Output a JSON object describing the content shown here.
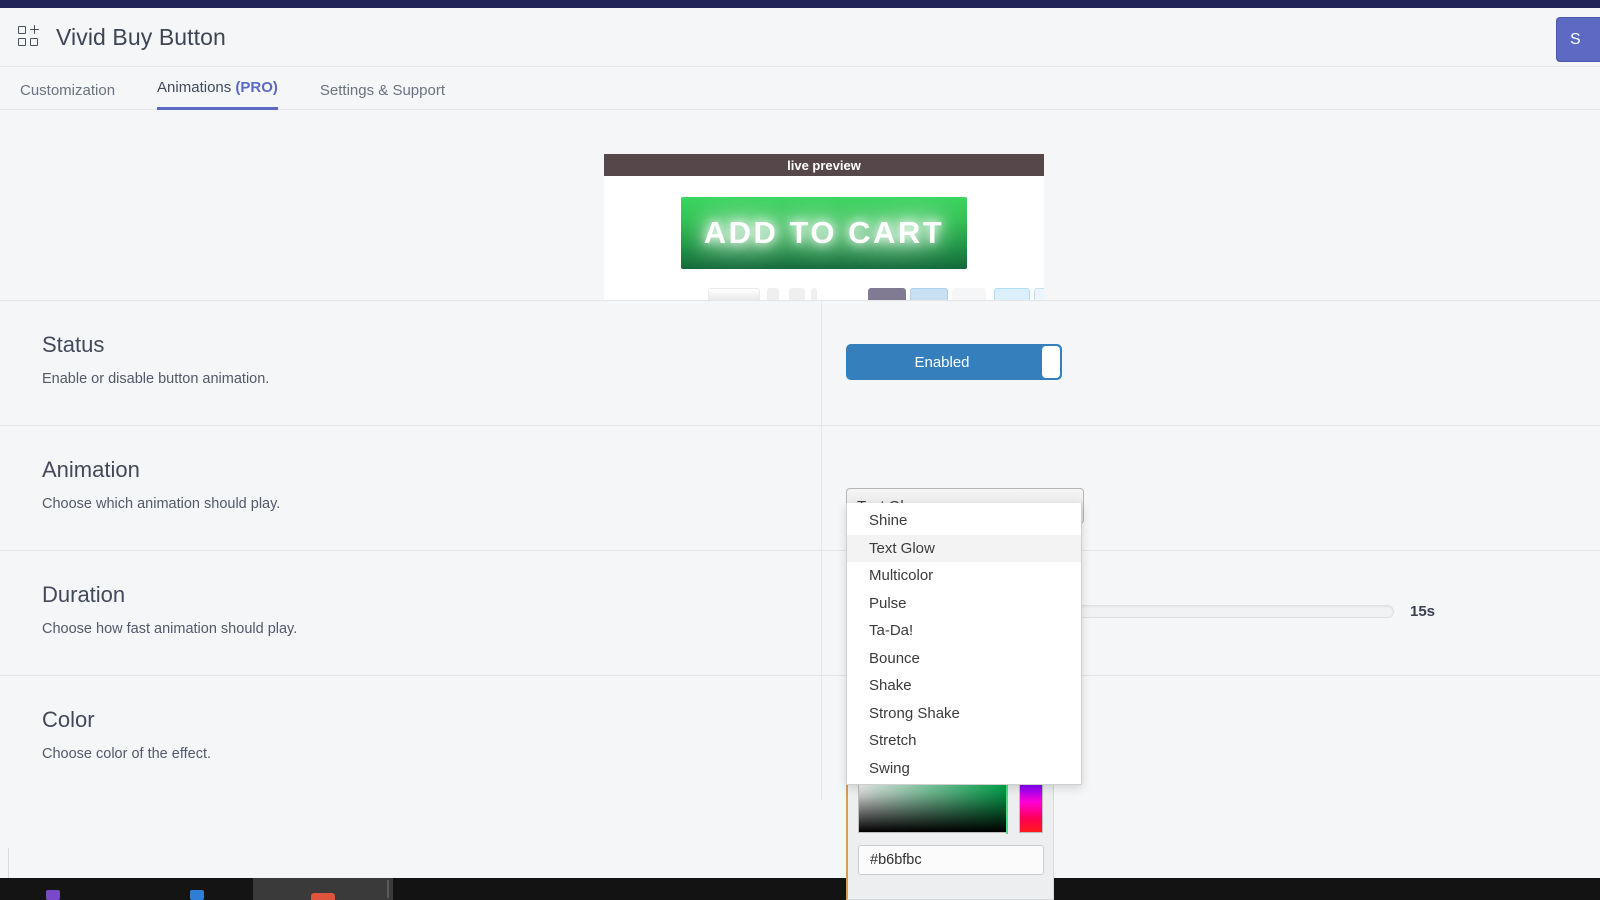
{
  "header": {
    "app_icon": "grid-plus-icon",
    "title": "Vivid Buy Button",
    "save_label": "S"
  },
  "tabs": [
    {
      "label": "Customization",
      "active": false,
      "pro": ""
    },
    {
      "label": "Animations ",
      "active": true,
      "pro": "(PRO)"
    },
    {
      "label": "Settings & Support",
      "active": false,
      "pro": ""
    }
  ],
  "preview": {
    "bar_label": "live preview",
    "button_label": "ADD TO CART",
    "button_gradient_top": "#3ad65f",
    "button_gradient_bottom": "#13683a",
    "bar_color": "#55474a"
  },
  "rows": {
    "status": {
      "title": "Status",
      "desc": "Enable or disable button animation.",
      "toggle_label": "Enabled",
      "toggle_color": "#3580bc",
      "toggle_state": "on"
    },
    "animation": {
      "title": "Animation",
      "desc": "Choose which animation should play.",
      "selected": "Text Glow",
      "caret_icon": "chevron-down-icon",
      "options": [
        "Shine",
        "Text Glow",
        "Multicolor",
        "Pulse",
        "Ta-Da!",
        "Bounce",
        "Shake",
        "Strong Shake",
        "Stretch",
        "Swing"
      ]
    },
    "duration": {
      "title": "Duration",
      "desc": "Choose how fast animation should play.",
      "value_label": "15s"
    },
    "color": {
      "title": "Color",
      "desc": "Choose color of the effect.",
      "hex_value": "#b6bfbc",
      "accent_border": "#d69b5f"
    }
  },
  "chrome": {
    "top_strip_color": "#202458",
    "accent_color": "#5c6ac4"
  }
}
